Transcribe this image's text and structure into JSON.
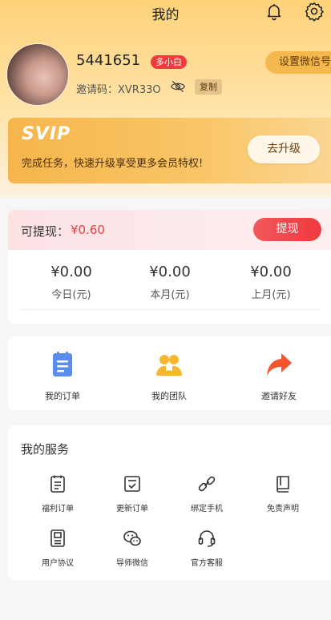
{
  "header": {
    "title": "我的"
  },
  "profile": {
    "user_id": "5441651",
    "level_badge": "多小白",
    "invite_code": "邀请码：XVR33O",
    "copy_label": "复制",
    "wechat_button": "设置微信号"
  },
  "svip": {
    "title": "SVIP",
    "description": "完成任务，快速升级享受更多会员特权!",
    "upgrade_button": "去升级"
  },
  "withdraw": {
    "label": "可提现：",
    "amount": "¥0.60",
    "button": "提现",
    "stats": [
      {
        "value": "¥0.00",
        "label": "今日(元)"
      },
      {
        "value": "¥0.00",
        "label": "本月(元)"
      },
      {
        "value": "¥0.00",
        "label": "上月(元)"
      }
    ]
  },
  "quick_actions": [
    {
      "label": "我的订单",
      "icon": "order-icon"
    },
    {
      "label": "我的团队",
      "icon": "team-icon"
    },
    {
      "label": "邀请好友",
      "icon": "share-icon"
    }
  ],
  "services": {
    "title": "我的服务",
    "items": [
      {
        "label": "福利订单",
        "icon": "welfare-order-icon"
      },
      {
        "label": "更新订单",
        "icon": "update-order-icon"
      },
      {
        "label": "绑定手机",
        "icon": "link-icon"
      },
      {
        "label": "免责声明",
        "icon": "book-icon"
      },
      {
        "label": "用户协议",
        "icon": "agreement-icon"
      },
      {
        "label": "导师微信",
        "icon": "wechat-icon"
      },
      {
        "label": "官方客服",
        "icon": "headset-icon"
      }
    ]
  },
  "colors": {
    "accent_red": "#ef3b3b",
    "gold": "#f6b54c",
    "icon_blue": "#5b8def",
    "icon_yellow": "#f5b731",
    "icon_orange": "#f4552c"
  }
}
